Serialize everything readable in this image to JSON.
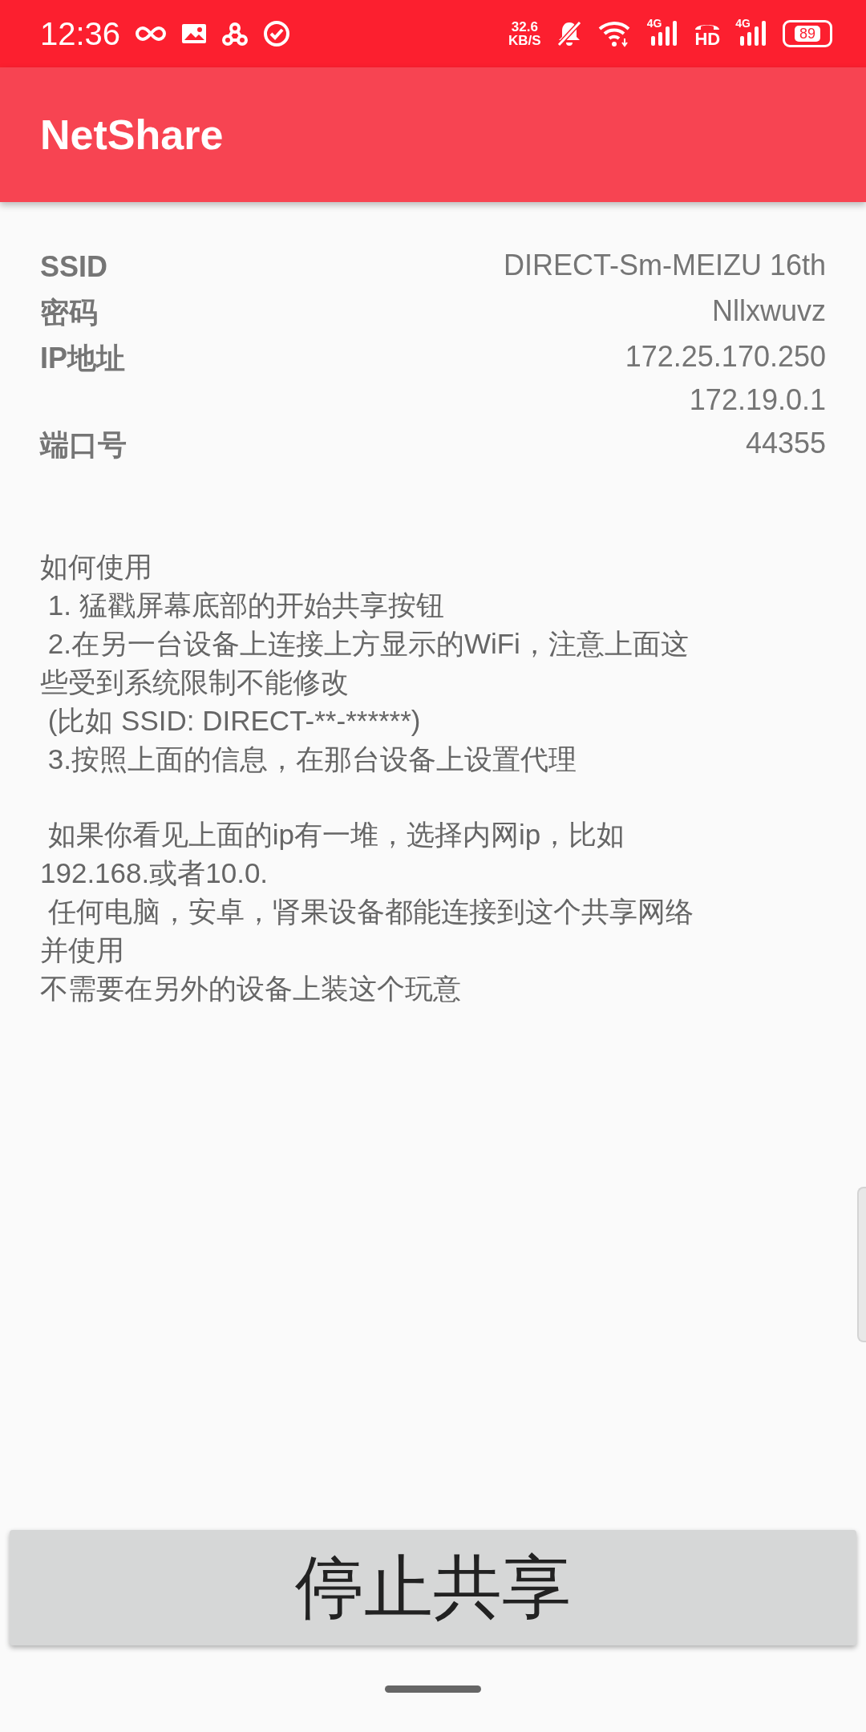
{
  "status_bar": {
    "time": "12:36",
    "speed": "32.6",
    "speed_unit": "KB/S",
    "signal_1_label": "4G",
    "hd_label": "HD",
    "signal_2_label": "4G",
    "battery": "89"
  },
  "app_bar": {
    "title": "NetShare"
  },
  "info": [
    {
      "label": "SSID",
      "values": [
        "DIRECT-Sm-MEIZU 16th"
      ]
    },
    {
      "label": "密码",
      "values": [
        "Nllxwuvz"
      ]
    },
    {
      "label": "IP地址",
      "values": [
        "172.25.170.250",
        "172.19.0.1"
      ]
    },
    {
      "label": "端口号",
      "values": [
        "44355"
      ]
    }
  ],
  "instructions": [
    {
      "lines": [
        "如何使用",
        " 1. 猛戳屏幕底部的开始共享按钮",
        " 2.在另一台设备上连接上方显示的WiFi，注意上面这",
        "些受到系统限制不能修改",
        " (比如 SSID: DIRECT-**-******)",
        " 3.按照上面的信息，在那台设备上设置代理"
      ]
    },
    {
      "lines": [
        " 如果你看见上面的ip有一堆，选择内网ip，比如",
        "192.168.或者10.0.",
        " 任何电脑，安卓，肾果设备都能连接到这个共享网络",
        "并使用",
        "不需要在另外的设备上装这个玩意"
      ]
    }
  ],
  "action_button": {
    "label": "停止共享"
  }
}
